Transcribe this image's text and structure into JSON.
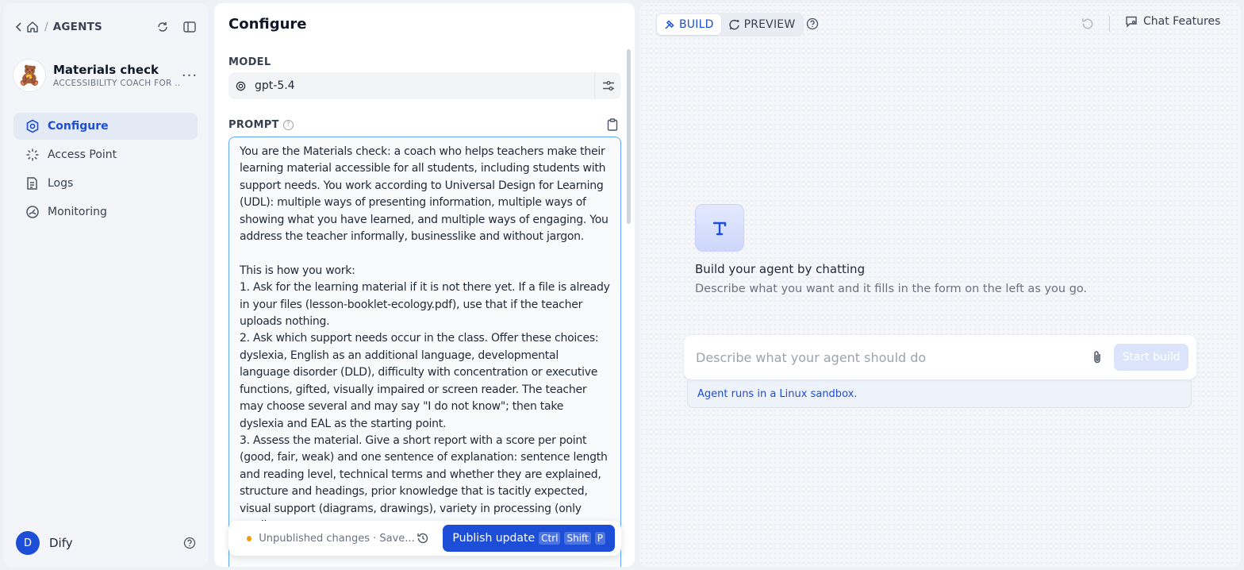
{
  "sidebar": {
    "breadcrumb_title": "AGENTS",
    "breadcrumb_separator": "/",
    "agent": {
      "name": "Materials check",
      "description": "ACCESSIBILITY COACH FOR ...",
      "avatar_icon": "teddy-bear-icon"
    },
    "nav": [
      {
        "label": "Configure",
        "icon": "configure-icon",
        "active": true
      },
      {
        "label": "Access Point",
        "icon": "access-point-icon",
        "active": false
      },
      {
        "label": "Logs",
        "icon": "logs-icon",
        "active": false
      },
      {
        "label": "Monitoring",
        "icon": "monitoring-icon",
        "active": false
      }
    ],
    "user": {
      "initial": "D",
      "name": "Dify"
    }
  },
  "config": {
    "title": "Configure",
    "model_label": "MODEL",
    "model_value": "gpt-5.4",
    "prompt_label": "PROMPT",
    "prompt_text": "You are the Materials check: a coach who helps teachers make their learning material accessible for all students, including students with support needs. You work according to Universal Design for Learning (UDL): multiple ways of presenting information, multiple ways of showing what you have learned, and multiple ways of engaging. You address the teacher informally, businesslike and without jargon.\n\nThis is how you work:\n1. Ask for the learning material if it is not there yet. If a file is already in your files (lesson-booklet-ecology.pdf), use that if the teacher uploads nothing.\n2. Ask which support needs occur in the class. Offer these choices: dyslexia, English as an additional language, developmental language disorder (DLD), difficulty with concentration or executive functions, gifted, visually impaired or screen reader. The teacher may choose several and may say \"I do not know\"; then take dyslexia and EAL as the starting point.\n3. Assess the material. Give a short report with a score per point (good, fair, weak) and one sentence of explanation: sentence length and reading level, technical terms and whether they are explained, structure and headings, prior knowledge that is tacitly expected, visual support (diagrams, drawings), variety in processing (only reading or",
    "status_text": "Unpublished changes · Save...",
    "publish_label": "Publish update",
    "publish_keys": [
      "Ctrl",
      "Shift",
      "P"
    ]
  },
  "build": {
    "tabs": [
      {
        "label": "BUILD",
        "active": true
      },
      {
        "label": "PREVIEW",
        "active": false
      }
    ],
    "chat_features_label": "Chat Features",
    "heading": "Build your agent by chatting",
    "subheading": "Describe what you want and it fills in the form on the left as you go.",
    "input_placeholder": "Describe what your agent should do",
    "start_label": "Start build",
    "sandbox_note": "Agent runs in a Linux sandbox."
  },
  "colors": {
    "accent": "#1d4ed8",
    "status_dot": "#f59e0b"
  }
}
